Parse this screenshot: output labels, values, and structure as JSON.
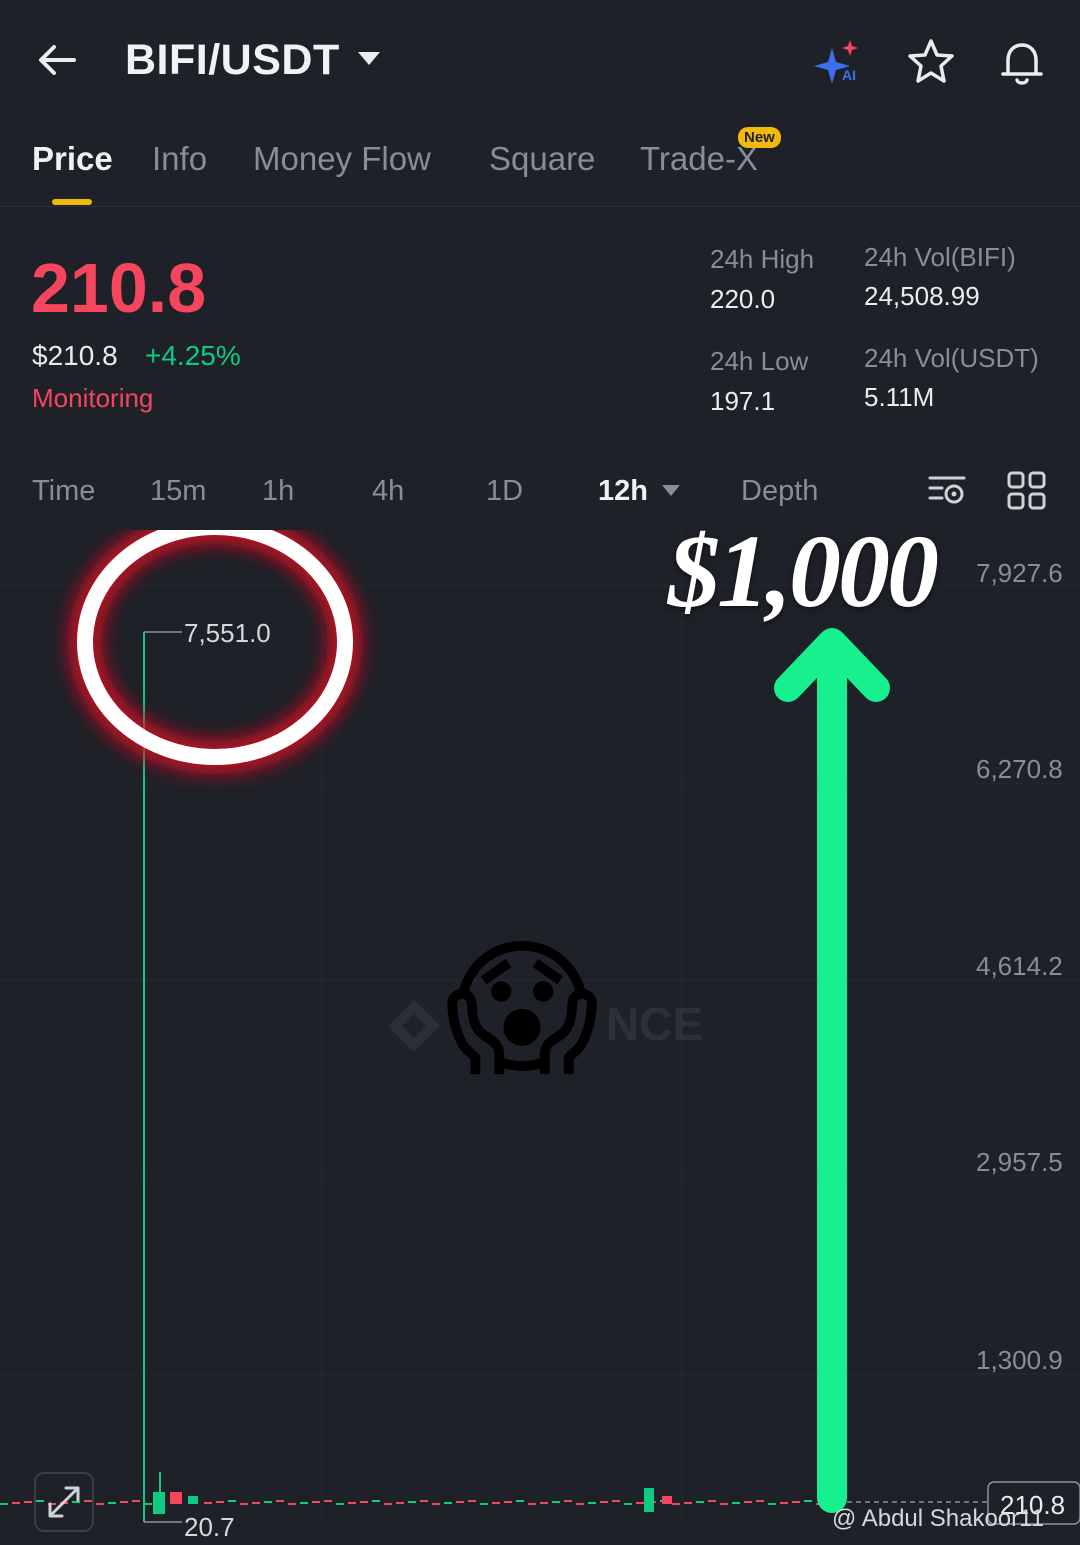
{
  "header": {
    "pair": "BIFI/USDT",
    "icons": [
      "back-arrow-icon",
      "ai-sparkle-icon",
      "star-icon",
      "bell-icon"
    ]
  },
  "tabs": [
    {
      "label": "Price",
      "active": true
    },
    {
      "label": "Info"
    },
    {
      "label": "Money Flow"
    },
    {
      "label": "Square"
    },
    {
      "label": "Trade-X",
      "badge": "New"
    }
  ],
  "price": {
    "last": "210.8",
    "usd": "$210.8",
    "change": "+4.25%",
    "tag": "Monitoring"
  },
  "stats": {
    "high_label": "24h High",
    "high_value": "220.0",
    "low_label": "24h Low",
    "low_value": "197.1",
    "vol_base_label": "24h Vol(BIFI)",
    "vol_base_value": "24,508.99",
    "vol_quote_label": "24h Vol(USDT)",
    "vol_quote_value": "5.11M"
  },
  "intervals": {
    "time": "Time",
    "m15": "15m",
    "h1": "1h",
    "h4": "4h",
    "d1": "1D",
    "selected": "12h",
    "depth": "Depth"
  },
  "chart": {
    "y_ticks": [
      "7,927.6",
      "6,270.8",
      "4,614.2",
      "2,957.5",
      "1,300.9"
    ],
    "max_label": "7,551.0",
    "min_label": "20.7",
    "current_label": "210.8",
    "watermark": "NCE"
  },
  "overlay": {
    "big_text": "$1,000",
    "emoji": "😱",
    "credit": "@ Abdul Shakoor11"
  },
  "colors": {
    "background": "#1e2128",
    "up": "#0ecb81",
    "down": "#f6465d",
    "accent": "#f0b90b",
    "arrow": "#16f08f"
  }
}
